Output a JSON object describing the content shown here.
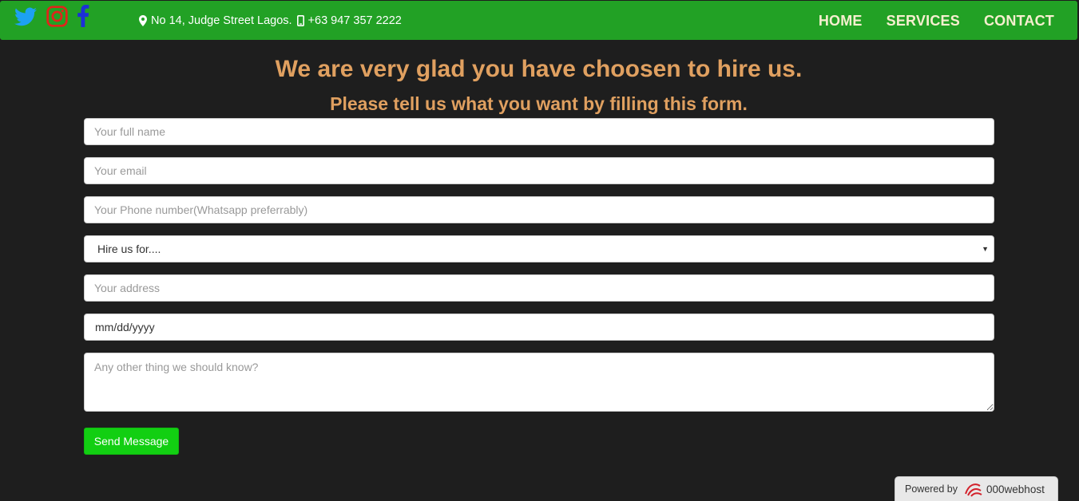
{
  "header": {
    "social": [
      "twitter-icon",
      "instagram-icon",
      "facebook-icon"
    ],
    "address": "No 14, Judge Street Lagos.",
    "phone": "+63 947 357 2222",
    "nav": [
      "HOME",
      "SERVICES",
      "CONTACT"
    ],
    "colors": {
      "bar": "#22a125",
      "nav_text": "#f7efcf"
    }
  },
  "main": {
    "title": "We are very glad you have choosen to hire us.",
    "subtitle": "Please tell us what you want by filling this form.",
    "form": {
      "name_placeholder": "Your full name",
      "email_placeholder": "Your email",
      "phone_placeholder": "Your Phone number(Whatsapp preferrably)",
      "service_selected": "Hire us for....",
      "address_placeholder": "Your address",
      "date_value": "mm/dd/yyyy",
      "message_placeholder": "Any other thing we should know?",
      "submit_label": "Send Message"
    }
  },
  "badge": {
    "prefix": "Powered by",
    "brand": "000webhost"
  },
  "colors": {
    "heading": "#e0a060",
    "button": "#12cf12",
    "background": "#1e1e1e"
  }
}
